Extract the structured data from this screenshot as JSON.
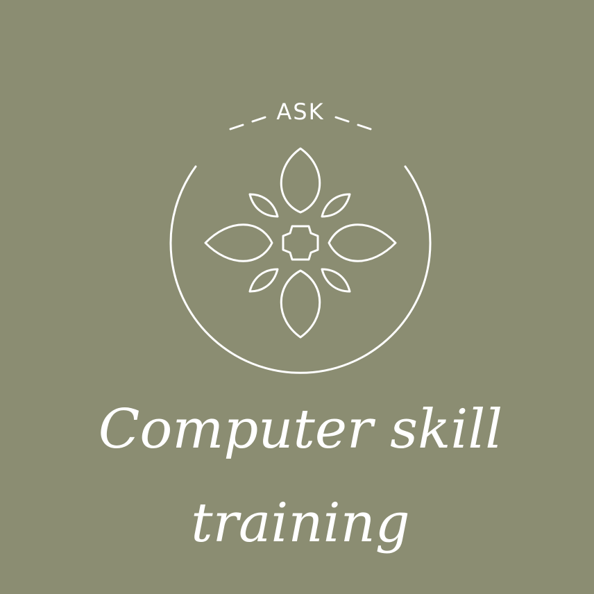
{
  "logo": {
    "brand": "ASK",
    "tagline_line1": "Computer skill",
    "tagline_line2": "training",
    "colors": {
      "background": "#8b8d72",
      "foreground": "#ffffff"
    },
    "emblem_icon": "four-petal-flower-icon"
  }
}
